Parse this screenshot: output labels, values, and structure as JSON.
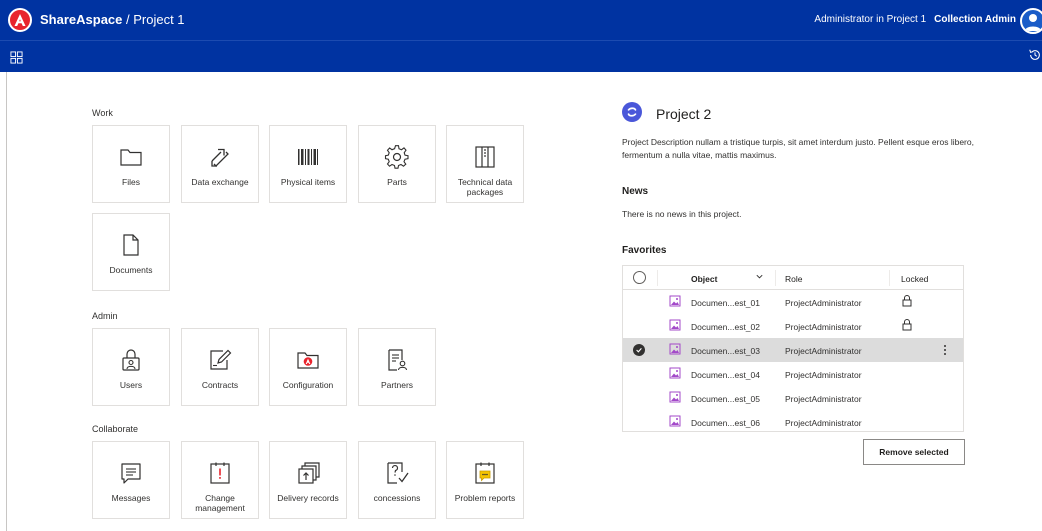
{
  "header": {
    "brand": "ShareAspace",
    "project": " / Project 1",
    "user_context": "Administrator in Project 1",
    "collection": "Collection Admin"
  },
  "icons": {
    "logo": "shareaspace-logo-icon",
    "apps": "app-grid-icon",
    "history": "history-icon",
    "avatar": "user-avatar-icon"
  },
  "sections": {
    "work": {
      "label": "Work",
      "tiles": [
        {
          "label": "Files",
          "icon": "folder-icon"
        },
        {
          "label": "Data exchange",
          "icon": "exchange-arrows-icon"
        },
        {
          "label": "Physical items",
          "icon": "barcode-icon"
        },
        {
          "label": "Parts",
          "icon": "gear-icon"
        },
        {
          "label": "Technical data packages",
          "icon": "package-icon"
        },
        {
          "label": "Documents",
          "icon": "document-icon"
        }
      ]
    },
    "admin": {
      "label": "Admin",
      "tiles": [
        {
          "label": "Users",
          "icon": "user-lock-icon"
        },
        {
          "label": "Contracts",
          "icon": "contract-edit-icon"
        },
        {
          "label": "Configuration",
          "icon": "configuration-folder-icon"
        },
        {
          "label": "Partners",
          "icon": "partners-icon"
        }
      ]
    },
    "collaborate": {
      "label": "Collaborate",
      "tiles": [
        {
          "label": "Messages",
          "icon": "message-icon"
        },
        {
          "label": "Change management",
          "icon": "change-management-icon"
        },
        {
          "label": "Delivery records",
          "icon": "delivery-records-icon"
        },
        {
          "label": "concessions",
          "icon": "concessions-icon"
        },
        {
          "label": "Problem reports",
          "icon": "problem-report-icon"
        }
      ]
    }
  },
  "project": {
    "title": "Project 2",
    "description": "Project Description nullam a tristique turpis, sit amet interdum justo. Pellent esque eros libero, fermentum a nulla vitae, mattis maximus.",
    "news_heading": "News",
    "news_text": "There is no news in this project.",
    "favorites_heading": "Favorites"
  },
  "favorites": {
    "columns": {
      "object": "Object",
      "role": "Role",
      "locked": "Locked"
    },
    "rows": [
      {
        "object": "Documen...est_01",
        "role": "ProjectAdministrator",
        "locked": true,
        "selected": false
      },
      {
        "object": "Documen...est_02",
        "role": "ProjectAdministrator",
        "locked": true,
        "selected": false
      },
      {
        "object": "Documen...est_03",
        "role": "ProjectAdministrator",
        "locked": false,
        "selected": true
      },
      {
        "object": "Documen...est_04",
        "role": "ProjectAdministrator",
        "locked": false,
        "selected": false
      },
      {
        "object": "Documen...est_05",
        "role": "ProjectAdministrator",
        "locked": false,
        "selected": false
      },
      {
        "object": "Documen...est_06",
        "role": "ProjectAdministrator",
        "locked": false,
        "selected": false
      }
    ],
    "remove_label": "Remove selected"
  },
  "colors": {
    "header_bg": "#0033a1",
    "logo_red": "#e8242d",
    "project_badge": "#4a57d9",
    "doc_icon_purple": "#a349c9",
    "selected_row": "#dcdcdc"
  }
}
